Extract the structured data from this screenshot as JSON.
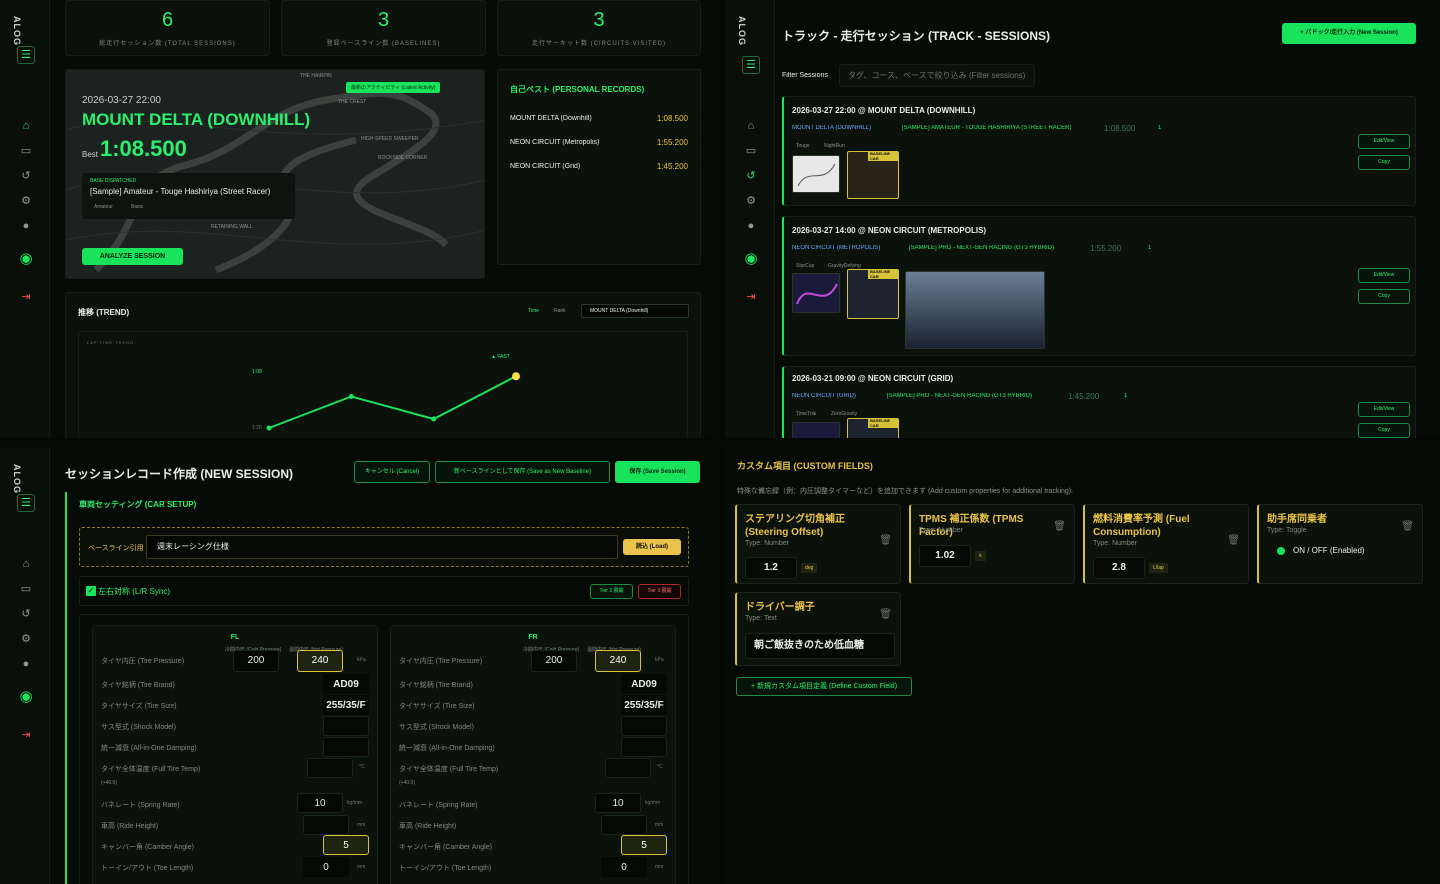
{
  "app": {
    "logo": "ALOG"
  },
  "dashboard": {
    "stats": [
      {
        "value": "6",
        "label": "総走行セッション数 (TOTAL SESSIONS)"
      },
      {
        "value": "3",
        "label": "登録ベースライン数 (BASELINES)"
      },
      {
        "value": "3",
        "label": "走行サーキット数 (CIRCUITS VISITED)"
      }
    ],
    "hero": {
      "badge": "最新のアクティビティ (Latest Activity)",
      "date": "2026-03-27 22:00",
      "track": "MOUNT DELTA (DOWNHILL)",
      "best_label": "Best",
      "best_time": "1:08.500",
      "base_dispatched": "BASE DISPATCHED",
      "base_name": "[Sample] Amateur - Touge Hashiriya (Street Racer)",
      "base_tags": [
        "Amateur",
        "Basic"
      ],
      "analyze": "ANALYZE SESSION",
      "map_labels": [
        "THE HAIRPIN",
        "THE CREST",
        "HIGH-SPEED SWEEPER",
        "ROCKSIDE CORNER",
        "RETAINING WALL"
      ]
    },
    "pr": {
      "title": "自己ベスト (PERSONAL RECORDS)",
      "rows": [
        {
          "track": "MOUNT DELTA (Downhill)",
          "time": "1:08.500"
        },
        {
          "track": "NEON CIRCUIT (Metropolis)",
          "time": "1:55.200"
        },
        {
          "track": "NEON CIRCUIT (Grid)",
          "time": "1:45.200"
        }
      ]
    },
    "trend": {
      "title": "推移 (TREND)",
      "tab_time": "Time",
      "tab_rank": "Rank",
      "select": "MOUNT DELTA (Downhill)",
      "chart_label": "LAP TIME TREND",
      "fast": "▲ FAST",
      "ytick_top": "1:08",
      "ytick_bottom": "1:20"
    }
  },
  "chart_data": {
    "type": "line",
    "title": "LAP TIME TREND",
    "yticks": [
      "1:08",
      "1:20"
    ],
    "ylim": [
      "1:20",
      "1:08"
    ],
    "values": [
      "1:20",
      "1:13",
      "1:18",
      "1:08.5"
    ],
    "annotation": "▲ FAST"
  },
  "sessions": {
    "title": "トラック - 走行セッション (TRACK - SESSIONS)",
    "new_button": "+ パドック/走行入力 (New Session)",
    "filter_label": "Filter Sessions",
    "filter_placeholder": "タグ、コース、ベースで絞り込み (Filter sessions)",
    "edit": "Edit/View",
    "copy": "Copy",
    "baseline_car": "BASELINE CAR",
    "items": [
      {
        "header": "2026-03-27 22:00 @ MOUNT DELTA (DOWNHILL)",
        "track": "MOUNT DELTA (DOWNHILL)",
        "car": "[SAMPLE] AMATEUR - TOUGE HASHIRIYA (STREET RACER)",
        "time": "1:08.500",
        "count": "1",
        "tags": [
          "Touge",
          "NightRun"
        ]
      },
      {
        "header": "2026-03-27 14:00 @ NEON CIRCUIT (METROPOLIS)",
        "track": "NEON CIRCUIT (METROPOLIS)",
        "car": "[SAMPLE] PRO - NEXT-GEN RACING (GT3 HYBRID)",
        "time": "1:55.200",
        "count": "1",
        "tags": [
          "StarCup",
          "GravityDefying"
        ]
      },
      {
        "header": "2026-03-21 09:00 @ NEON CIRCUIT (GRID)",
        "track": "NEON CIRCUIT (GRID)",
        "car": "[SAMPLE] PRO - NEXT-GEN RACING (GT3 HYBRID)",
        "time": "1:45.200",
        "count": "1",
        "tags": [
          "TimeTrial",
          "ZeroGravity"
        ]
      }
    ]
  },
  "newsession": {
    "title": "セッションレコード作成 (NEW SESSION)",
    "cancel": "キャンセル (Cancel)",
    "save_baseline": "新ベースラインとして保存 (Save as New Baseline)",
    "save": "保存 (Save Session)",
    "car_setup": "車両セッティング (CAR SETUP)",
    "baseline_label": "ベースライン引用",
    "baseline_value": "週末レーシング仕様",
    "load": "読込 (Load)",
    "sync": "左右対称 (L/R Sync)",
    "tier2": "Tier 2 展開",
    "tier3": "Tier 3 展開",
    "cold": "冷間内圧 (Cold Pressure)",
    "hot": "温間内圧 (Hot Pressure)",
    "kpa": "kPa",
    "wheels": [
      {
        "name": "FL"
      },
      {
        "name": "FR"
      }
    ],
    "fields": {
      "pressure": "タイヤ内圧 (Tire Pressure)",
      "brand": "タイヤ銘柄 (Tire Brand)",
      "size": "タイヤサイズ (Tire Size)",
      "shock": "サス型式 (Shock Model)",
      "damping": "統一減衰 (All-in-One Damping)",
      "temp": "タイヤ全体温度 (Full Tire Temp)",
      "temp_unit": "°C",
      "temp_note": "(+40.0)",
      "spring": "バネレート (Spring Rate)",
      "spring_unit": "kg/mm",
      "ride": "車高 (Ride Height)",
      "mm": "mm",
      "camber": "キャンバー角 (Camber Angle)",
      "toe": "トーイン/アウト (Toe Length)"
    },
    "values": {
      "cold": "200",
      "hot": "240",
      "brand": "AD09",
      "size": "255/35/F",
      "spring": "10",
      "camber": "5",
      "toe": "0"
    }
  },
  "custom": {
    "title": "カスタム項目 (CUSTOM FIELDS)",
    "desc": "特殊な備忘録（例：内圧調整タイマーなど）を追加できます (Add custom properties for additional tracking).",
    "fields": [
      {
        "name": "ステアリング切角補正 (Steering Offset)",
        "type": "Type: Number",
        "value": "1.2",
        "unit": "deg"
      },
      {
        "name": "TPMS 補正係数 (TPMS Factor)",
        "type": "Type: Number",
        "value": "1.02",
        "unit": "x"
      },
      {
        "name": "燃料消費率予測 (Fuel Consumption)",
        "type": "Type: Number",
        "value": "2.8",
        "unit": "L/lap"
      },
      {
        "name": "助手席同乗者",
        "type": "Type: Toggle",
        "value": "ON / OFF (Enabled)"
      },
      {
        "name": "ドライバー調子",
        "type": "Type: Text",
        "value": "朝ご飯抜きのため低血糖"
      }
    ],
    "add": "+ 新規カスタム項目定義 (Define Custom Field)"
  }
}
